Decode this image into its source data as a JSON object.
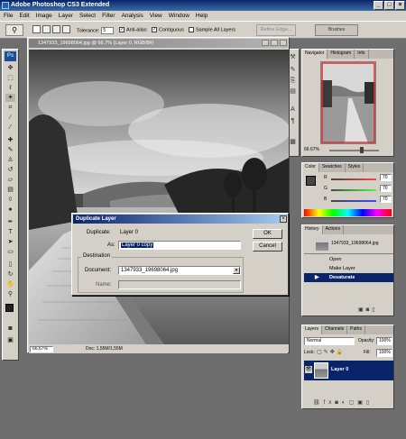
{
  "app": {
    "title": "Adobe Photoshop CS3 Extended"
  },
  "window_controls": {
    "minimize": "_",
    "maximize": "□",
    "close": "×"
  },
  "menu": [
    "File",
    "Edit",
    "Image",
    "Layer",
    "Select",
    "Filter",
    "Analysis",
    "View",
    "Window",
    "Help"
  ],
  "options_bar": {
    "tolerance_label": "Tolerance:",
    "tolerance_value": "5",
    "anti_alias_label": "Anti-alias",
    "contiguous_label": "Contiguous",
    "sample_all_label": "Sample All Layers",
    "refine_edge_label": "Refine Edge...",
    "brushes_tab": "Brushes"
  },
  "document": {
    "title": "1347933_19698064.jpg @ 66,7% (Layer 0, RGB/8#)",
    "zoom": "66,67%",
    "doc_size": "Doc: 1,55M/1,55M"
  },
  "dialog": {
    "title": "Duplicate Layer",
    "duplicate_label": "Duplicate:",
    "duplicate_value": "Layer 0",
    "as_label": "As:",
    "as_value": "Layer 0 copy",
    "ok_label": "OK",
    "cancel_label": "Cancel",
    "destination_label": "Destination",
    "document_label": "Document:",
    "document_value": "1347933_19698064.jpg",
    "name_label": "Name:",
    "name_value": ""
  },
  "navigator_panel": {
    "tabs": [
      "Navigator",
      "Histogram",
      "Info"
    ],
    "zoom": "66.67%"
  },
  "color_panel": {
    "tabs": [
      "Color",
      "Swatches",
      "Styles"
    ],
    "channels": [
      {
        "label": "R",
        "value": "70",
        "color": "#c03030"
      },
      {
        "label": "G",
        "value": "70",
        "color": "#30a030"
      },
      {
        "label": "B",
        "value": "70",
        "color": "#3030c0"
      }
    ]
  },
  "history_panel": {
    "tabs": [
      "History",
      "Actions"
    ],
    "snapshot": "1347933_19698064.jpg",
    "items": [
      "Open",
      "Make Layer",
      "Desaturate"
    ],
    "selected": "Desaturate"
  },
  "layers_panel": {
    "tabs": [
      "Layers",
      "Channels",
      "Paths"
    ],
    "blend_mode": "Normal",
    "opacity_label": "Opacity:",
    "opacity_value": "100%",
    "lock_label": "Lock:",
    "fill_label": "Fill:",
    "fill_value": "100%",
    "layer_name": "Layer 0"
  },
  "colors": {
    "accent": "#0a246a",
    "chrome": "#d4d0c8",
    "navigator_frame": "#e03030"
  }
}
